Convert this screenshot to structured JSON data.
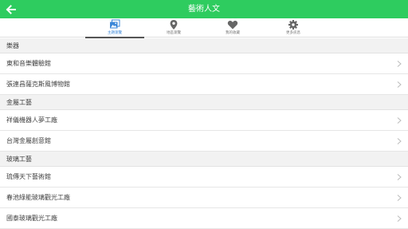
{
  "header": {
    "title": "藝術人文",
    "bg_color": "#2ecc5f"
  },
  "tabs": [
    {
      "label": "主題瀏覽",
      "icon": "image-icon",
      "active": true
    },
    {
      "label": "地區瀏覽",
      "icon": "map-pin-icon",
      "active": false
    },
    {
      "label": "我的收藏",
      "icon": "heart-icon",
      "active": false
    },
    {
      "label": "更多訊息",
      "icon": "gear-icon",
      "active": false
    }
  ],
  "sections": [
    {
      "title": "樂器",
      "items": [
        "東和音樂體驗館",
        "張連昌薩克斯風博物館"
      ]
    },
    {
      "title": "金屬工藝",
      "items": [
        "祥儀機器人夢工廠",
        "台灣金屬創意館"
      ]
    },
    {
      "title": "玻璃工藝",
      "items": [
        "琉傳天下藝術館",
        "春池綠能玻璃觀光工廠",
        "國泰玻璃觀光工廠"
      ]
    }
  ]
}
